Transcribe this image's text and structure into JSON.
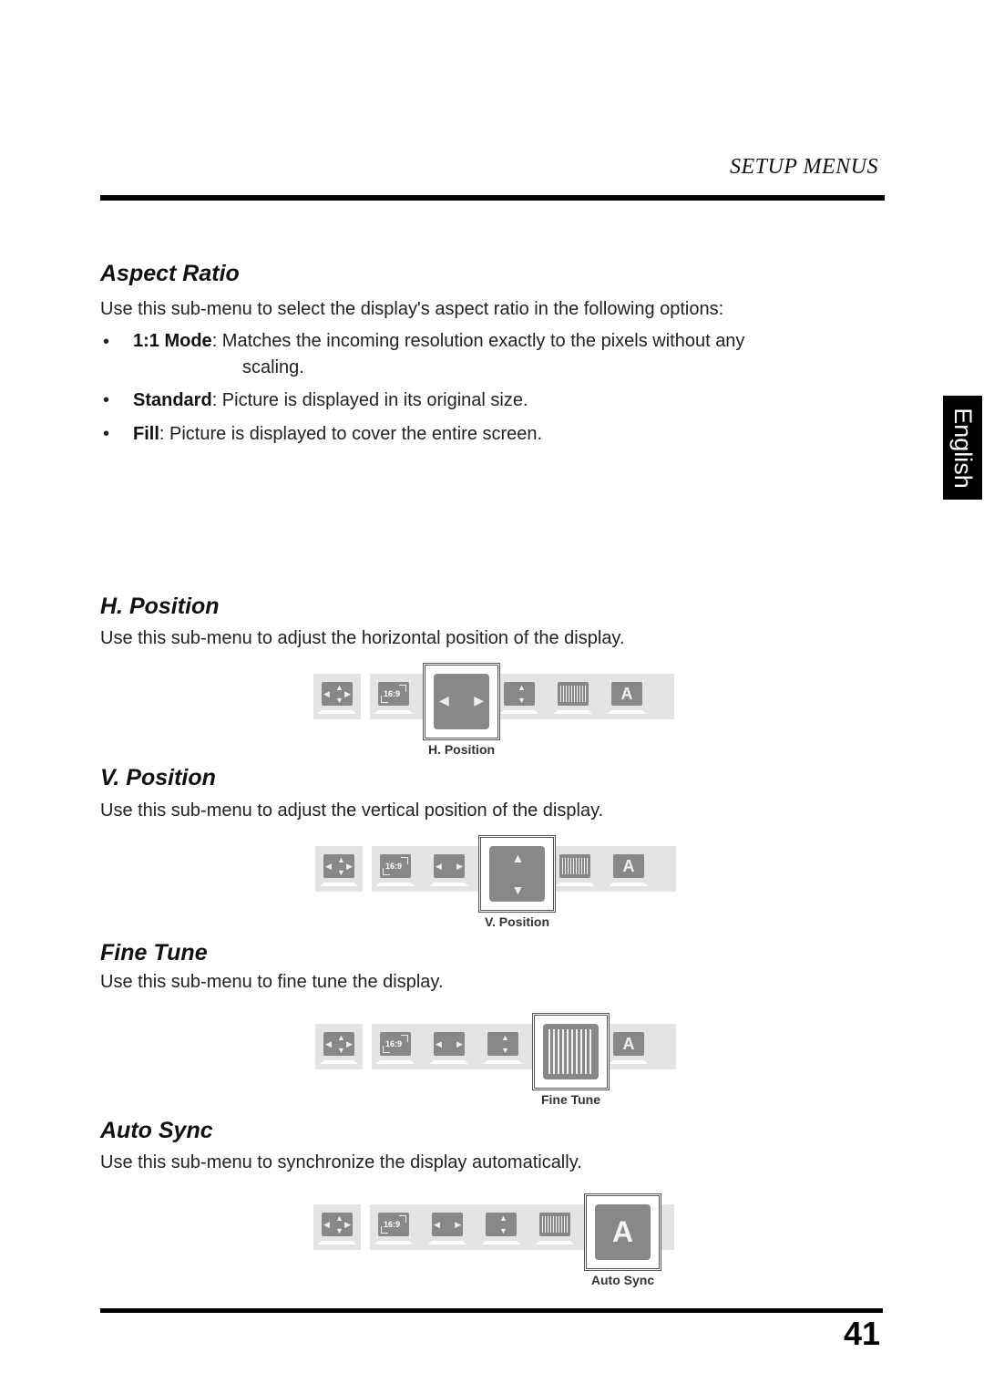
{
  "header": {
    "section_title": "SETUP MENUS"
  },
  "language_tab": "English",
  "page_number": "41",
  "sections": {
    "aspect_ratio": {
      "title": "Aspect Ratio",
      "intro": "Use this sub-menu to select the display's aspect ratio in the following options:",
      "options": [
        {
          "term": "1:1 Mode",
          "desc_line1": ": Matches the incoming resolution exactly to the pixels without any",
          "desc_line2": "scaling."
        },
        {
          "term": "Standard",
          "desc": ": Picture is displayed in its original size."
        },
        {
          "term": "Fill",
          "desc": ": Picture is displayed to cover the entire screen."
        }
      ]
    },
    "h_position": {
      "title": "H. Position",
      "desc": "Use this sub-menu to adjust the horizontal position of the display.",
      "caption": "H. Position"
    },
    "v_position": {
      "title": "V. Position",
      "desc": "Use this sub-menu to adjust the vertical position of the display.",
      "caption": "V. Position"
    },
    "fine_tune": {
      "title": "Fine Tune",
      "desc": "Use this sub-menu to fine tune the display.",
      "caption": "Fine Tune"
    },
    "auto_sync": {
      "title": "Auto Sync",
      "desc": "Use this sub-menu to synchronize the display automatically.",
      "caption": "Auto Sync"
    }
  },
  "osd_icons": {
    "aspect_label": "16:9",
    "auto_label": "A",
    "items": [
      "position",
      "aspect-ratio",
      "h-position",
      "v-position",
      "fine-tune",
      "auto-sync"
    ]
  }
}
